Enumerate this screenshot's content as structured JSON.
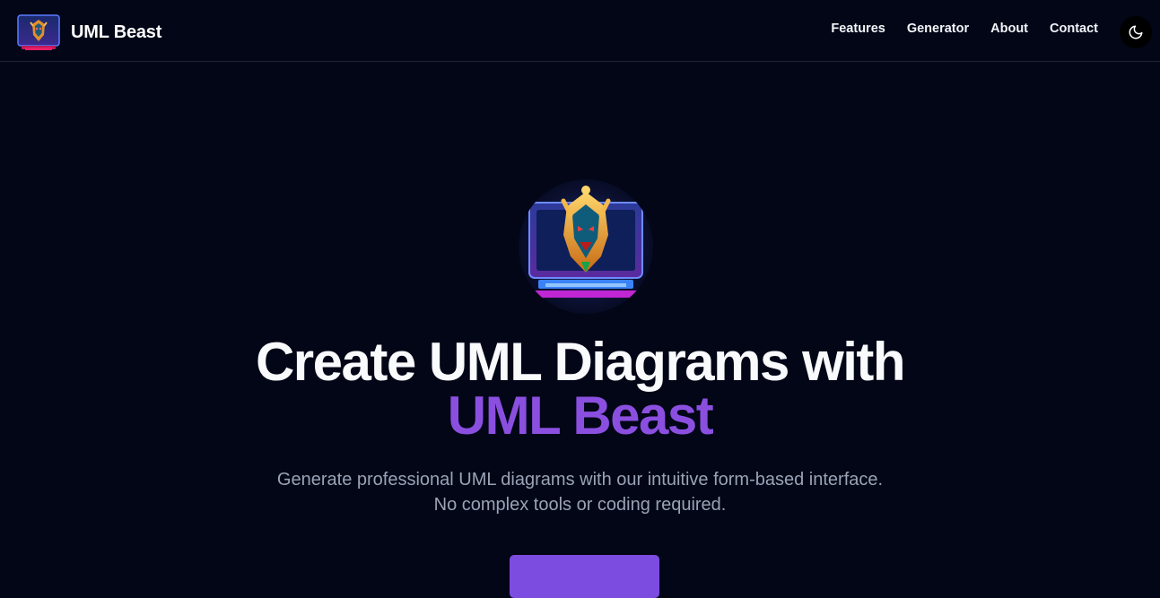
{
  "brand": {
    "name": "UML Beast",
    "logo_icon": "wolf-computer-logo"
  },
  "nav": {
    "links": [
      {
        "label": "Features"
      },
      {
        "label": "Generator"
      },
      {
        "label": "About"
      },
      {
        "label": "Contact"
      }
    ],
    "theme_toggle_icon": "moon-icon"
  },
  "hero": {
    "logo_icon": "wolf-computer-logo",
    "title_line1": "Create UML Diagrams with",
    "title_accent": "UML Beast",
    "subtitle": "Generate professional UML diagrams with our intuitive form-based interface. No complex tools or coding required.",
    "cta_label": ""
  },
  "colors": {
    "background": "#020617",
    "accent": "#8b4fe0",
    "button": "#7c4ce0",
    "text": "#f8fafc",
    "muted_text": "#9aa3b5"
  }
}
